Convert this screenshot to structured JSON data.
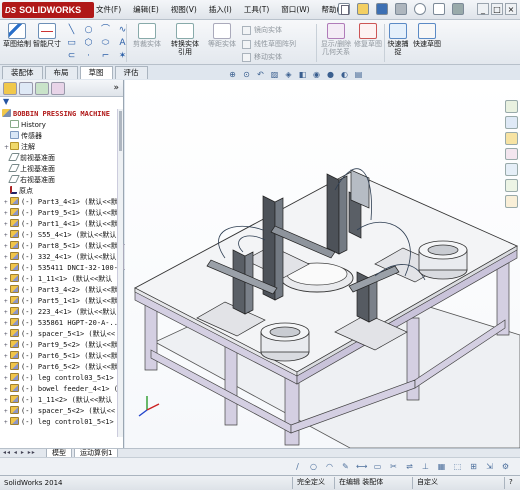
{
  "title_bar": {
    "brand": "SOLIDWORKS",
    "menu": [
      "文件(F)",
      "编辑(E)",
      "视图(V)",
      "插入(I)",
      "工具(T)",
      "窗口(W)",
      "帮助(H)"
    ],
    "window_controls": [
      "_",
      "□",
      "×"
    ]
  },
  "command_manager": {
    "sketch_label": "草图绘制",
    "smart_dim_label": "智能尺寸",
    "cut_entities": "剪裁实体",
    "convert_entities": "转换实体引用",
    "offset_entities": "等距实体",
    "mirror_entities": "镜向实体",
    "linear_pattern": "线性草图阵列",
    "move_entities": "移动实体",
    "display_relations": "显示/删除几何关系",
    "repair_sketch": "修复草图",
    "rapid_snap": "快速捕捉",
    "rapid_sketch": "快速草图"
  },
  "cm_tabs": [
    "装配体",
    "布局",
    "草图",
    "评估"
  ],
  "cm_active_tab": "草图",
  "feature_tree": {
    "root": "BOBBIN PRESSING MACHINE",
    "items": [
      {
        "exp": "",
        "icon": "hist",
        "label": "History"
      },
      {
        "exp": "",
        "icon": "sens",
        "label": "传感器"
      },
      {
        "exp": "+",
        "icon": "ann",
        "label": "注解"
      },
      {
        "exp": "",
        "icon": "plane",
        "label": "前视基准面"
      },
      {
        "exp": "",
        "icon": "plane",
        "label": "上视基准面"
      },
      {
        "exp": "",
        "icon": "plane",
        "label": "右视基准面"
      },
      {
        "exp": "",
        "icon": "origin",
        "label": "原点"
      },
      {
        "exp": "+",
        "icon": "part",
        "label": "(-) Part3_4<1> (默认<<默"
      },
      {
        "exp": "+",
        "icon": "part",
        "label": "(-) Part9_5<1> (默认<<默"
      },
      {
        "exp": "+",
        "icon": "part",
        "label": "(-) Part1_4<1> (默认<<默"
      },
      {
        "exp": "+",
        "icon": "part",
        "label": "(-) S55_4<1> (默认<<默认"
      },
      {
        "exp": "+",
        "icon": "part",
        "label": "(-) Part8_5<1> (默认<<默"
      },
      {
        "exp": "+",
        "icon": "part",
        "label": "(-) 332_4<1> (默认<<默认"
      },
      {
        "exp": "+",
        "icon": "part",
        "label": "(-) 535411 DNCI-32-100-P"
      },
      {
        "exp": "+",
        "icon": "part",
        "label": "(-) 1_11<1> (默认<<默认"
      },
      {
        "exp": "+",
        "icon": "part",
        "label": "(-) Part3_4<2> (默认<<默"
      },
      {
        "exp": "+",
        "icon": "part",
        "label": "(-) Part5_1<1> (默认<<默"
      },
      {
        "exp": "+",
        "icon": "part",
        "label": "(-) 223_4<1> (默认<<默认"
      },
      {
        "exp": "+",
        "icon": "part",
        "label": "(-) 535861 HGPT-20-A-..."
      },
      {
        "exp": "+",
        "icon": "part",
        "label": "(-) spacer_5<1> (默认<<"
      },
      {
        "exp": "+",
        "icon": "part",
        "label": "(-) Part9_5<2> (默认<<默"
      },
      {
        "exp": "+",
        "icon": "part",
        "label": "(-) Part6_5<1> (默认<<默"
      },
      {
        "exp": "+",
        "icon": "part",
        "label": "(-) Part6_5<2> (默认<<默"
      },
      {
        "exp": "+",
        "icon": "part",
        "label": "(-) leg control03_5<1>"
      },
      {
        "exp": "+",
        "icon": "part",
        "label": "(-) bowel feeder_4<1> ("
      },
      {
        "exp": "+",
        "icon": "part",
        "label": "(-) 1_11<2> (默认<<默认"
      },
      {
        "exp": "+",
        "icon": "part",
        "label": "(-) spacer_5<2> (默认<<"
      },
      {
        "exp": "+",
        "icon": "part",
        "label": "(-) leg control01_5<1>"
      }
    ]
  },
  "bottom_tabs": [
    "模型",
    "运动算例1"
  ],
  "nav_arrows": "◂◂ ◂ ▸ ▸▸",
  "status_bar": {
    "app": "SolidWorks 2014",
    "state": "完全定义",
    "mode": "在编辑 装配体",
    "units": "自定义",
    "help": "?"
  },
  "colors": {
    "brand": "#b01818",
    "table_top": "#f3f4f6",
    "frame": "#d4cfe2",
    "gfx_bg": "#ffffff"
  }
}
